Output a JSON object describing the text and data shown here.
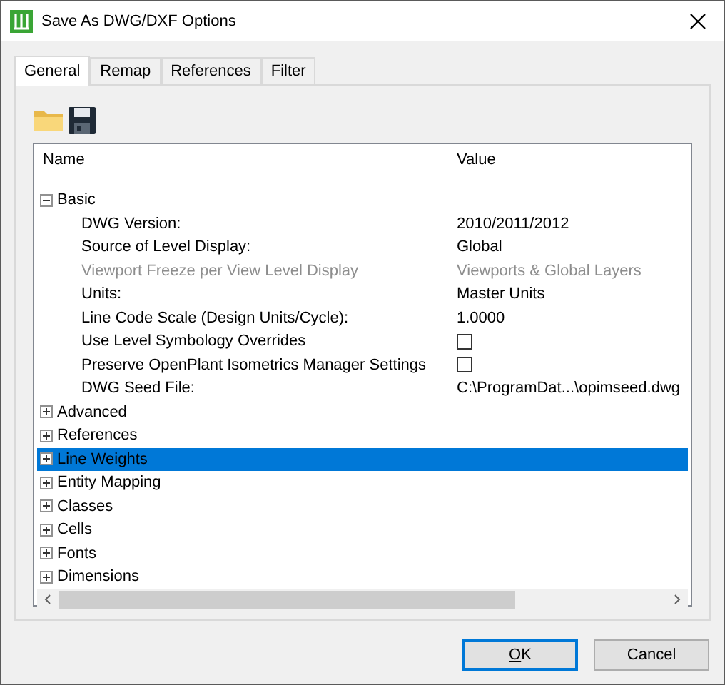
{
  "window": {
    "title": "Save As DWG/DXF Options"
  },
  "tabs": [
    {
      "label": "General",
      "selected": true
    },
    {
      "label": "Remap",
      "selected": false
    },
    {
      "label": "References",
      "selected": false
    },
    {
      "label": "Filter",
      "selected": false
    }
  ],
  "table": {
    "columns": [
      "Name",
      "Value"
    ],
    "rows": [
      {
        "label": "Basic",
        "expanded": true,
        "selected": false,
        "children": [
          {
            "label": "DWG Version:",
            "kind": "text",
            "value": "2010/2011/2012",
            "disabled": false
          },
          {
            "label": "Source of Level Display:",
            "kind": "text",
            "value": "Global",
            "disabled": false
          },
          {
            "label": "Viewport Freeze per View Level Display",
            "kind": "text",
            "value": "Viewports & Global Layers",
            "disabled": true
          },
          {
            "label": "Units:",
            "kind": "text",
            "value": "Master Units",
            "disabled": false
          },
          {
            "label": "Line Code Scale (Design Units/Cycle):",
            "kind": "text",
            "value": "1.0000",
            "disabled": false
          },
          {
            "label": "Use Level Symbology Overrides",
            "kind": "checkbox",
            "checked": false,
            "disabled": false
          },
          {
            "label": "Preserve OpenPlant Isometrics Manager Settings",
            "kind": "checkbox",
            "checked": false,
            "disabled": false
          },
          {
            "label": "DWG Seed File:",
            "kind": "text",
            "value": "C:\\ProgramDat...\\opimseed.dwg",
            "disabled": false
          }
        ]
      },
      {
        "label": "Advanced",
        "expanded": false,
        "selected": false
      },
      {
        "label": "References",
        "expanded": false,
        "selected": false
      },
      {
        "label": "Line Weights",
        "expanded": false,
        "selected": true
      },
      {
        "label": "Entity Mapping",
        "expanded": false,
        "selected": false
      },
      {
        "label": "Classes",
        "expanded": false,
        "selected": false
      },
      {
        "label": "Cells",
        "expanded": false,
        "selected": false
      },
      {
        "label": "Fonts",
        "expanded": false,
        "selected": false
      },
      {
        "label": "Dimensions",
        "expanded": false,
        "selected": false
      }
    ]
  },
  "buttons": [
    {
      "label": "OK",
      "default": true,
      "mnemonic_underlined": true
    },
    {
      "label": "Cancel",
      "default": false,
      "mnemonic_underlined": false
    }
  ]
}
